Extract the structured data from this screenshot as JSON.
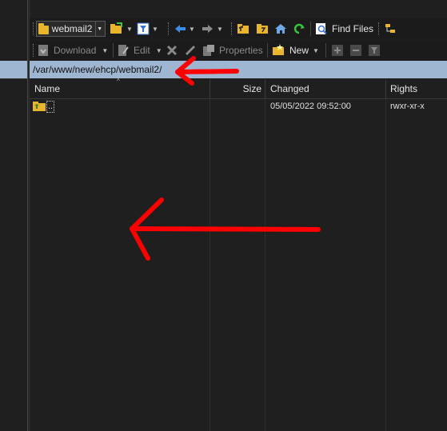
{
  "toolbar": {
    "session_combo": "webmail2",
    "find_files": "Find Files"
  },
  "actions": {
    "download": "Download",
    "edit": "Edit",
    "properties": "Properties",
    "new": "New"
  },
  "address": {
    "path": "/var/www/new/ehcp/webmail2/"
  },
  "columns": {
    "name": "Name",
    "size": "Size",
    "changed": "Changed",
    "rights": "Rights"
  },
  "rows": [
    {
      "name": "..",
      "size": "",
      "changed": "05/05/2022 09:52:00",
      "rights": "rwxr-xr-x"
    }
  ],
  "colors": {
    "address_bg": "#9fb6d3",
    "annotation_red": "#ff0000",
    "folder": "#e8b52c"
  }
}
